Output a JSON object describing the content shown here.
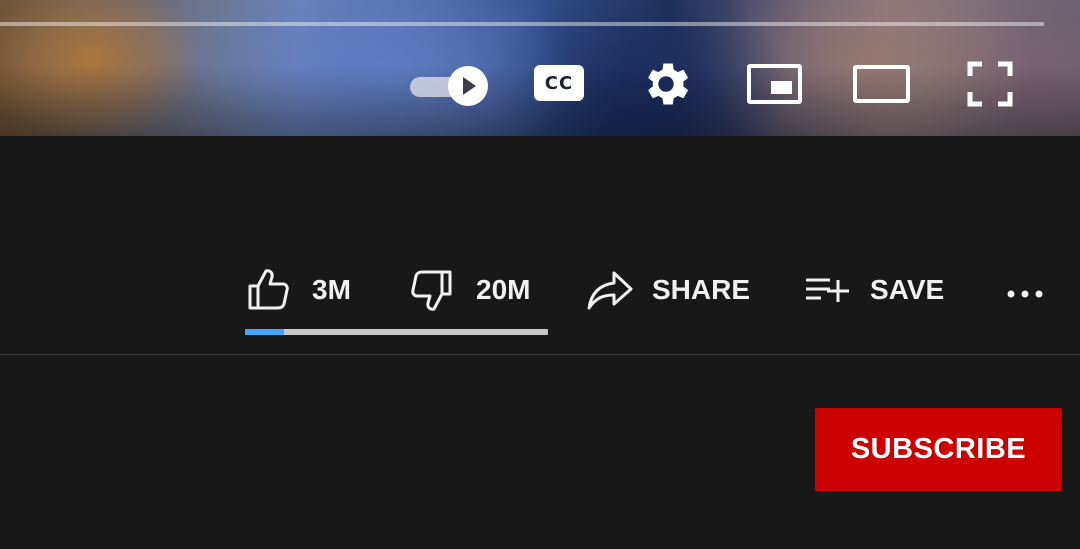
{
  "player": {
    "controls": {
      "autoplay": {
        "icon": "autoplay-toggle-icon",
        "state": "on"
      },
      "captions": {
        "label": "CC",
        "icon": "closed-captions-icon"
      },
      "settings": {
        "icon": "gear-icon"
      },
      "miniplayer": {
        "icon": "miniplayer-icon"
      },
      "theater": {
        "icon": "theater-mode-icon"
      },
      "fullscreen": {
        "icon": "fullscreen-icon"
      }
    }
  },
  "actions": {
    "like": {
      "count": "3M",
      "icon": "thumbs-up-icon"
    },
    "dislike": {
      "count": "20M",
      "icon": "thumbs-down-icon"
    },
    "share": {
      "label": "SHARE",
      "icon": "share-arrow-icon"
    },
    "save": {
      "label": "SAVE",
      "icon": "playlist-add-icon"
    },
    "more": {
      "icon": "more-horizontal-icon"
    }
  },
  "sentiment": {
    "like_fraction": 0.13,
    "like_color": "#3ea6ff",
    "track_color": "#c8c8c8"
  },
  "subscribe": {
    "label": "SUBSCRIBE",
    "color": "#cc0000"
  },
  "colors": {
    "background": "#181818",
    "text": "#f1f1f1"
  }
}
